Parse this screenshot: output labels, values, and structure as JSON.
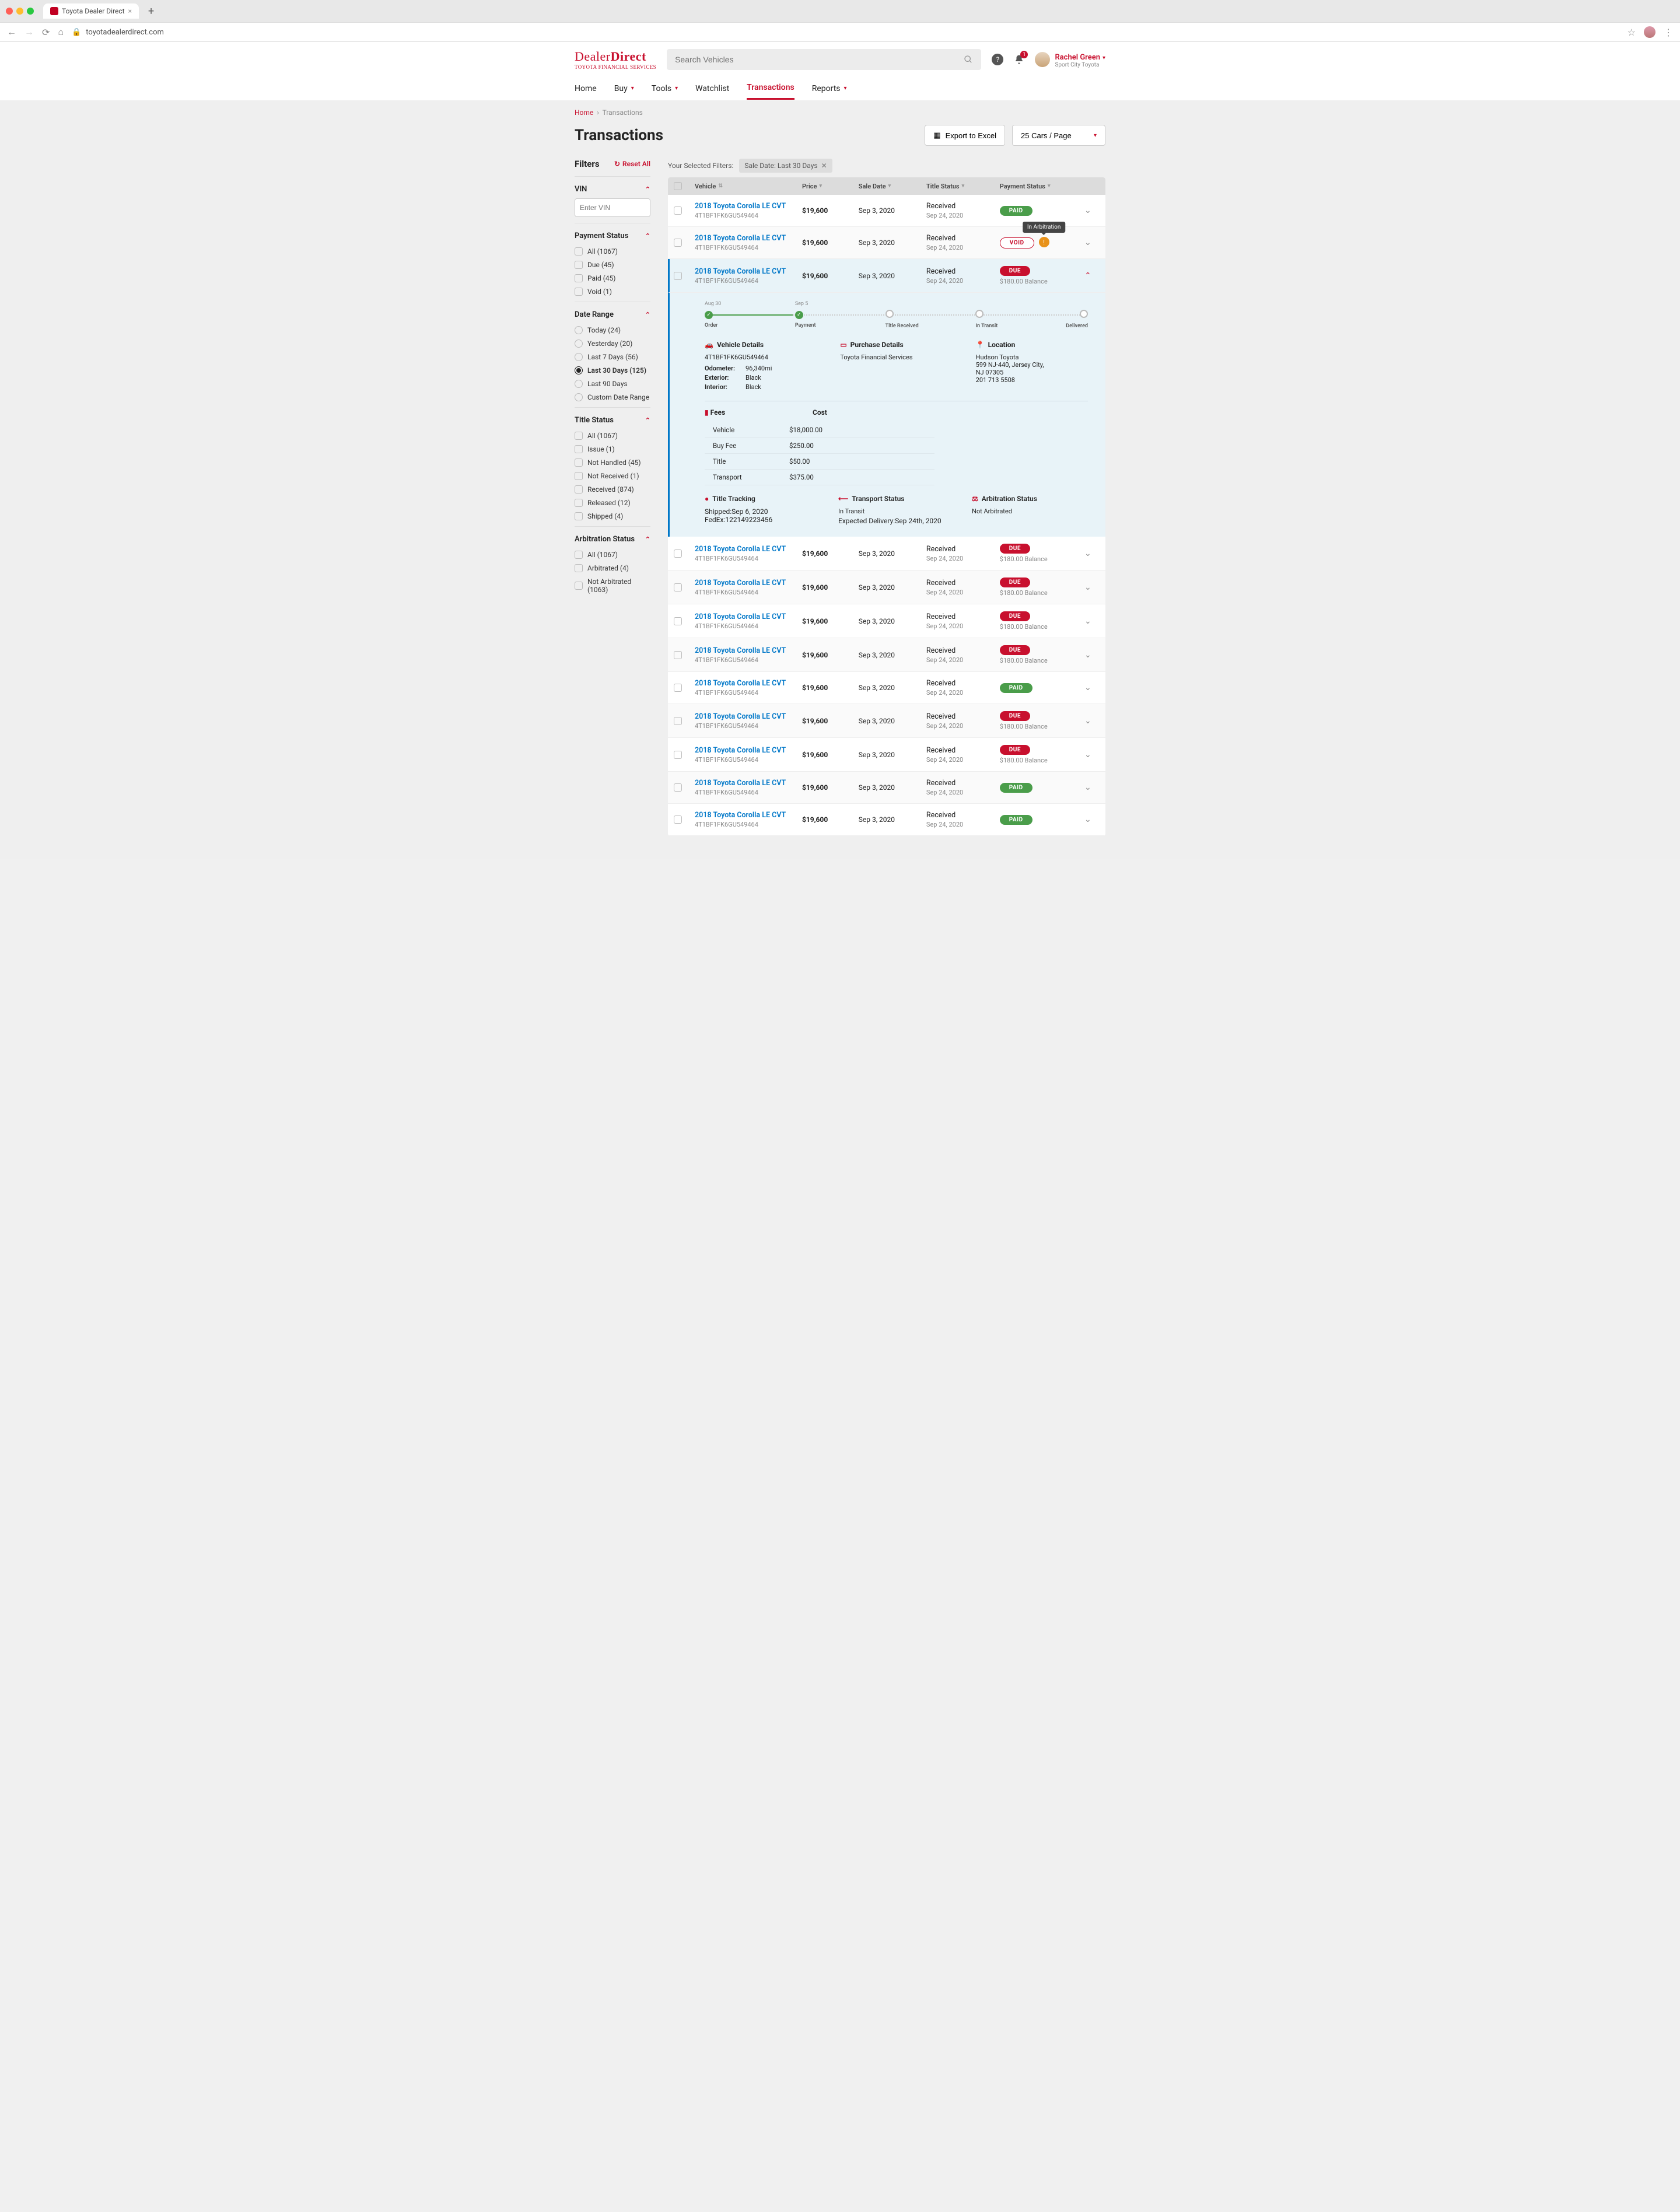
{
  "browser": {
    "tab_title": "Toyota Dealer Direct",
    "url": "toyotadealerdirect.com"
  },
  "logo": {
    "line1_a": "Dealer",
    "line1_b": "Direct",
    "line2": "TOYOTA FINANCIAL SERVICES"
  },
  "search": {
    "placeholder": "Search Vehicles"
  },
  "notif_count": "1",
  "user": {
    "name": "Rachel Green",
    "store": "Sport City Toyota"
  },
  "nav": {
    "home": "Home",
    "buy": "Buy",
    "tools": "Tools",
    "watchlist": "Watchlist",
    "transactions": "Transactions",
    "reports": "Reports"
  },
  "crumbs": {
    "home": "Home",
    "current": "Transactions"
  },
  "page_title": "Transactions",
  "export_btn": "Export to Excel",
  "page_select": "25 Cars / Page",
  "filters_title": "Filters",
  "reset_all": "Reset All",
  "selected_filters_label": "Your Selected Filters:",
  "chip": "Sale Date: Last 30 Days",
  "filter_groups": {
    "vin": {
      "title": "VIN",
      "placeholder": "Enter VIN"
    },
    "payment": {
      "title": "Payment Status",
      "opts": [
        "All (1067)",
        "Due (45)",
        "Paid (45)",
        "Void (1)"
      ]
    },
    "date": {
      "title": "Date Range",
      "opts": [
        "Today (24)",
        "Yesterday (20)",
        "Last 7 Days (56)",
        "Last 30 Days (125)",
        "Last 90 Days",
        "Custom Date Range"
      ],
      "selected": 3
    },
    "title": {
      "title": "Title Status",
      "opts": [
        "All (1067)",
        "Issue (1)",
        "Not Handled (45)",
        "Not Received (1)",
        "Received (874)",
        "Released (12)",
        "Shipped (4)"
      ]
    },
    "arb": {
      "title": "Arbitration Status",
      "opts": [
        "All (1067)",
        "Arbitrated (4)",
        "Not Arbitrated (1063)"
      ]
    }
  },
  "cols": {
    "vehicle": "Vehicle",
    "price": "Price",
    "sale": "Sale Date",
    "title": "Title Status",
    "payment": "Payment Status"
  },
  "row_defaults": {
    "vehicle": "2018 Toyota Corolla LE CVT",
    "vin": "4T1BF1FK6GU549464",
    "price": "$19,600",
    "sale_date": "Sep 3, 2020",
    "title_status": "Received",
    "title_date": "Sep 24, 2020",
    "balance": "$180.00 Balance"
  },
  "rows": [
    {
      "status": "PAID"
    },
    {
      "status": "VOID",
      "arb_tooltip": "In Arbitration"
    },
    {
      "status": "DUE",
      "expanded": true
    },
    {
      "status": "DUE"
    },
    {
      "status": "DUE"
    },
    {
      "status": "DUE"
    },
    {
      "status": "DUE"
    },
    {
      "status": "PAID"
    },
    {
      "status": "DUE"
    },
    {
      "status": "DUE"
    },
    {
      "status": "PAID"
    },
    {
      "status": "PAID"
    }
  ],
  "timeline": [
    {
      "date": "Aug 30",
      "label": "Order",
      "done": true
    },
    {
      "date": "Sep 5",
      "label": "Payment",
      "done": true
    },
    {
      "date": "",
      "label": "Title Received",
      "done": false
    },
    {
      "date": "",
      "label": "In Transit",
      "done": false
    },
    {
      "date": "",
      "label": "Delivered",
      "done": false
    }
  ],
  "detail": {
    "vehicle_h": "Vehicle Details",
    "vin": "4T1BF1FK6GU549464",
    "odometer_k": "Odometer:",
    "odometer_v": "96,340mi",
    "exterior_k": "Exterior:",
    "exterior_v": "Black",
    "interior_k": "Interior:",
    "interior_v": "Black",
    "purchase_h": "Purchase Details",
    "purchase_v": "Toyota Financial Services",
    "location_h": "Location",
    "loc_name": "Hudson Toyota",
    "loc_addr": "599 NJ-440, Jersey City,",
    "loc_city": "NJ 07305",
    "loc_phone": "201 713 5508",
    "fees_h": "Fees",
    "cost_h": "Cost",
    "fees": [
      {
        "name": "Vehicle",
        "cost": "$18,000.00"
      },
      {
        "name": "Buy Fee",
        "cost": "$250.00"
      },
      {
        "name": "Title",
        "cost": "$50.00"
      },
      {
        "name": "Transport",
        "cost": "$375.00"
      }
    ],
    "title_track_h": "Title Tracking",
    "shipped_k": "Shipped:",
    "shipped_v": "Sep 6, 2020",
    "fedex_k": "FedEx:",
    "fedex_v": "122149223456",
    "transport_h": "Transport Status",
    "transport_status": "In Transit",
    "expected_k": "Expected Delivery:",
    "expected_v": "Sep 24th, 2020",
    "arb_h": "Arbitration Status",
    "arb_v": "Not Arbitrated"
  }
}
